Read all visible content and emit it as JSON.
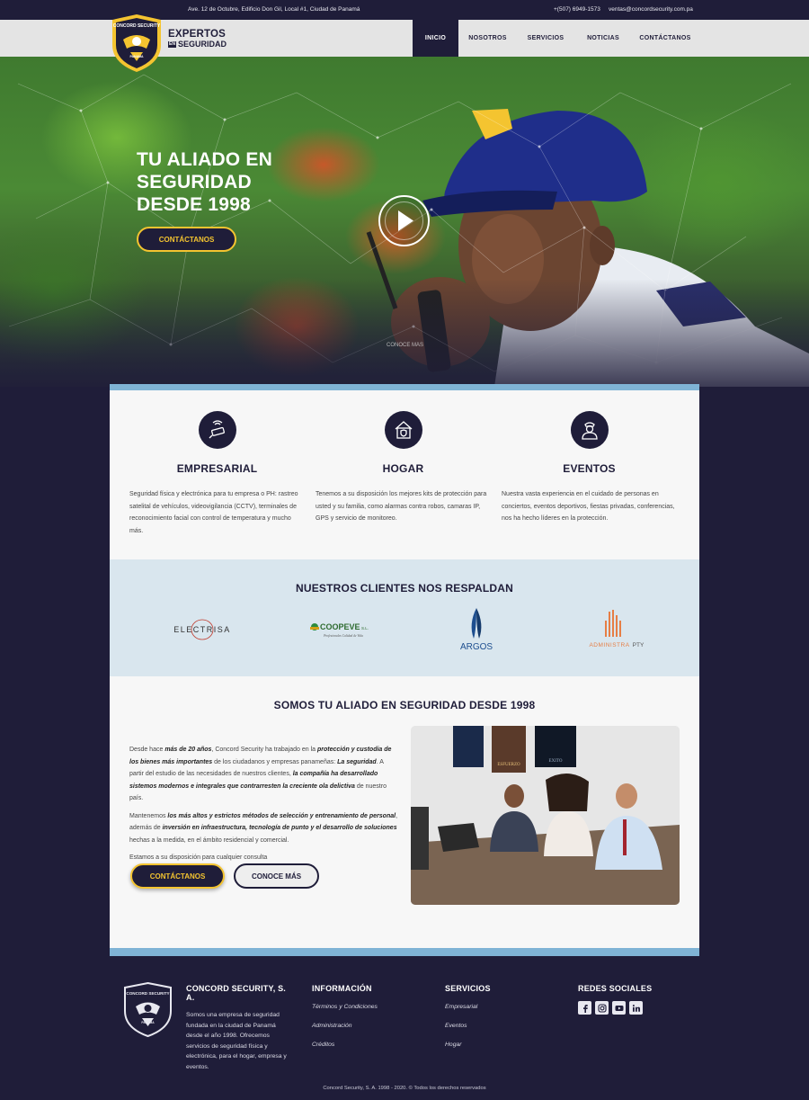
{
  "topbar": {
    "address": "Ave. 12 de Octubre, Edificio Don Gil, Local #1, Ciudad de Panamá",
    "phone": "+(507) 6949-1573",
    "email": "ventas@concordsecurity.com.pa"
  },
  "brand": {
    "line1": "EXPERTOS",
    "en": "EN",
    "line2": "SEGURIDAD",
    "badge_top": "CONCORD SECURITY",
    "badge_bottom": "PANAMA"
  },
  "nav": {
    "items": [
      {
        "label": "INICIO",
        "active": true
      },
      {
        "label": "NOSOTROS",
        "active": false
      },
      {
        "label": "SERVICIOS",
        "active": false
      },
      {
        "label": "NOTICIAS",
        "active": false
      },
      {
        "label": "CONTÁCTANOS",
        "active": false
      }
    ]
  },
  "hero": {
    "title_line1": "TU ALIADO EN",
    "title_line2": "SEGURIDAD",
    "title_line3": "DESDE 1998",
    "cta": "CONTÁCTANOS",
    "scroll_hint": "CONOCE MÁS",
    "play_icon": "play-icon"
  },
  "services": [
    {
      "icon": "cctv-camera-icon",
      "title": "EMPRESARIAL",
      "text": "Seguridad física y electrónica para tu empresa o PH: rastreo satelital de vehículos, videovigilancia (CCTV), terminales de reconocimiento facial con control de temperatura y mucho más."
    },
    {
      "icon": "house-shield-icon",
      "title": "HOGAR",
      "text": "Tenemos a su disposición los mejores kits de protección para usted y su familia, como alarmas contra robos, camaras IP, GPS y servicio de monitoreo."
    },
    {
      "icon": "security-guard-icon",
      "title": "EVENTOS",
      "text": "Nuestra vasta experiencia en el cuidado de personas en conciertos, eventos deportivos, fiestas privadas, conferencias, nos ha hecho líderes en la protección."
    }
  ],
  "clients": {
    "heading": "NUESTROS CLIENTES NOS RESPALDAN",
    "logos": [
      {
        "name": "ELECTRISA"
      },
      {
        "name": "COOPEVE",
        "suffix": "S.L.",
        "tagline": "Profesionales Calidad de Vida"
      },
      {
        "name": "ARGOS"
      },
      {
        "name": "ADMINISTRA",
        "suffix": "PTY"
      }
    ]
  },
  "about": {
    "heading": "SOMOS TU ALIADO EN SEGURIDAD DESDE 1998",
    "p1_a": "Desde hace ",
    "p1_b": "más de 20 años",
    "p1_c": ", Concord Security ha trabajado en la ",
    "p1_d": "protección y custodia de los bienes más importantes",
    "p1_e": " de los ciudadanos y empresas panameñas: ",
    "p1_f": "La seguridad",
    "p1_g": ". A partir del estudio de las necesidades de nuestros clientes, ",
    "p1_h": "la compañía ha desarrollado sistemos modernos e integrales que contrarresten la creciente ola delictiva",
    "p1_i": " de nuestro país.",
    "p2_a": "Mantenemos ",
    "p2_b": "los más altos y estrictos métodos de selección y entrenamiento de personal",
    "p2_c": ", además de ",
    "p2_d": "inversión en infraestructura, tecnología de punto y el desarrollo de soluciones",
    "p2_e": " hechas a la medida, en el ámbito residencial y comercial.",
    "p3": "Estamos a su disposición para cualquier consulta",
    "btn_contact": "CONTÁCTANOS",
    "btn_more": "CONOCE MÁS",
    "poster1": "ESFUERZO",
    "poster2": "EXITO"
  },
  "footer": {
    "company": "CONCORD SECURITY, S. A.",
    "about": "Somos una empresa de seguridad fundada en la ciudad de Panamá desde el año 1998. Ofrecemos servicios de seguridad física y electrónica, para el hogar, empresa y eventos.",
    "info_heading": "INFORMACIÓN",
    "info_links": [
      "Términos y Condiciones",
      "Administración",
      "Créditos"
    ],
    "services_heading": "SERVICIOS",
    "services_links": [
      "Empresarial",
      "Eventos",
      "Hogar"
    ],
    "social_heading": "REDES SOCIALES",
    "social": [
      "facebook-icon",
      "instagram-icon",
      "youtube-icon",
      "linkedin-icon"
    ],
    "copyright": "Concord Security, S. A. 1998 - 2020. © Todos los derechos reservados"
  },
  "colors": {
    "navy": "#1f1d39",
    "gold": "#f4c430",
    "stripe": "#7fb3d5",
    "clients_bg": "#d9e6ee"
  }
}
